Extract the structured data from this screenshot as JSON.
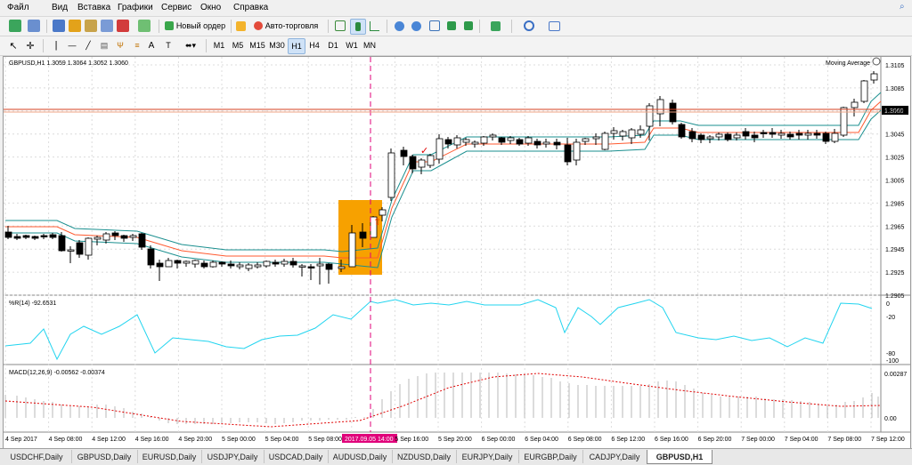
{
  "menu": [
    "Файл",
    "Вид",
    "Вставка",
    "Графики",
    "Сервис",
    "Окно",
    "Справка"
  ],
  "toolbar": {
    "new_order": "Новый ордер",
    "auto_trading": "Авто-торговля",
    "icons": [
      "new-chart-icon",
      "profiles-icon",
      "market-watch-icon",
      "data-window-icon",
      "navigator-icon",
      "terminal-icon",
      "tester-icon",
      "new-order-icon",
      "auto-trading-icon",
      "bar-chart-icon",
      "candlestick-icon",
      "line-chart-icon",
      "zoom-in-icon",
      "zoom-out-icon",
      "tile-windows-icon",
      "auto-scroll-icon",
      "chart-shift-icon",
      "indicators-icon",
      "periods-icon",
      "templates-icon"
    ]
  },
  "drawing_tools": {
    "text_label": "A",
    "timeframes": [
      "M1",
      "M5",
      "M15",
      "M30",
      "H1",
      "H4",
      "D1",
      "W1",
      "MN"
    ]
  },
  "chart": {
    "header": "GBPUSD,H1  1.3059 1.3064 1.3052 1.3060",
    "ma_label": "Moving Average",
    "price_ticks": [
      "1.3105",
      "1.3085",
      "1.3065",
      "1.3045",
      "1.3025",
      "1.3005",
      "1.2985",
      "1.2965",
      "1.2945",
      "1.2925",
      "1.2905"
    ],
    "current_price": "1.3060",
    "wpr_label": "%R(14) -92.6531",
    "wpr_ticks": [
      "0",
      "-20",
      "-80",
      "-100"
    ],
    "macd_label": "MACD(12,26,9) -0.00562 -0.00374",
    "macd_ticks": [
      "0.00287",
      "0.00"
    ],
    "time_ticks": [
      "4 Sep 2017",
      "4 Sep 08:00",
      "4 Sep 12:00",
      "4 Sep 16:00",
      "4 Sep 20:00",
      "5 Sep 00:00",
      "5 Sep 04:00",
      "5 Sep 08:00",
      "2017.09.05 14:00",
      "5 Sep 16:00",
      "5 Sep 20:00",
      "6 Sep 00:00",
      "6 Sep 04:00",
      "6 Sep 08:00",
      "6 Sep 12:00",
      "6 Sep 16:00",
      "6 Sep 20:00",
      "7 Sep 00:00",
      "7 Sep 04:00",
      "7 Sep 08:00",
      "7 Sep 12:00"
    ],
    "colors": {
      "candle_up": "#ffffff",
      "candle_down": "#000000",
      "ma": "#ff6a00",
      "band": "#1a8f8f",
      "wpr": "#21d4ef",
      "macd_signal": "#e00000",
      "crosshair": "#e0007a",
      "highlight": "#f7a100",
      "price_line": "#d64020"
    }
  },
  "tabs": [
    "USDCHF,Daily",
    "GBPUSD,Daily",
    "EURUSD,Daily",
    "USDJPY,Daily",
    "USDCAD,Daily",
    "AUDUSD,Daily",
    "NZDUSD,Daily",
    "EURJPY,Daily",
    "EURGBP,Daily",
    "CADJPY,Daily",
    "GBPUSD,H1"
  ],
  "active_tab": "GBPUSD,H1"
}
